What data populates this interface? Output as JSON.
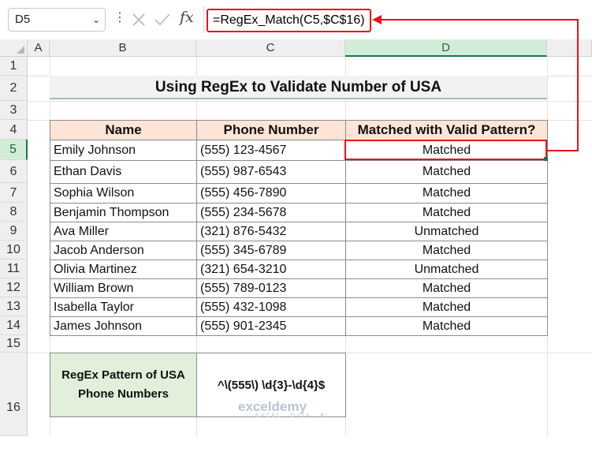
{
  "formula_bar": {
    "name_box": "D5",
    "formula": "=RegEx_Match(C5,$C$16)"
  },
  "columns": [
    "A",
    "B",
    "C",
    "D"
  ],
  "rows": [
    "1",
    "2",
    "3",
    "4",
    "5",
    "6",
    "7",
    "8",
    "9",
    "10",
    "11",
    "12",
    "13",
    "14",
    "15",
    "16"
  ],
  "sheet": {
    "title": "Using RegEx to Validate Number of USA",
    "headers": [
      "Name",
      "Phone Number",
      "Matched with Valid Pattern?"
    ],
    "records": [
      {
        "name": "Emily Johnson",
        "phone": "(555) 123-4567",
        "status": "Matched"
      },
      {
        "name": "Ethan Davis",
        "phone": "(555) 987-6543",
        "status": "Matched"
      },
      {
        "name": "Sophia Wilson",
        "phone": "(555) 456-7890",
        "status": "Matched"
      },
      {
        "name": "Benjamin Thompson",
        "phone": "(555) 234-5678",
        "status": "Matched"
      },
      {
        "name": "Ava Miller",
        "phone": "(321) 876-5432",
        "status": "Unmatched"
      },
      {
        "name": "Jacob Anderson",
        "phone": "(555) 345-6789",
        "status": "Matched"
      },
      {
        "name": "Olivia Martinez",
        "phone": "(321) 654-3210",
        "status": "Unmatched"
      },
      {
        "name": "William Brown",
        "phone": "(555) 789-0123",
        "status": "Matched"
      },
      {
        "name": "Isabella Taylor",
        "phone": "(555) 432-1098",
        "status": "Matched"
      },
      {
        "name": "James Johnson",
        "phone": "(555) 901-2345",
        "status": "Matched"
      }
    ],
    "pattern_label_line1": "RegEx Pattern of USA",
    "pattern_label_line2": "Phone Numbers",
    "pattern_value": "^\\(555\\) \\d{3}-\\d{4}$"
  },
  "watermark": {
    "name": "exceldemy",
    "tagline": "EXCEL · DATA · BI"
  },
  "colors": {
    "highlight": "#e8131a",
    "selection": "#217346",
    "header_fill": "#fce4d6",
    "pattern_fill": "#e2efda"
  }
}
